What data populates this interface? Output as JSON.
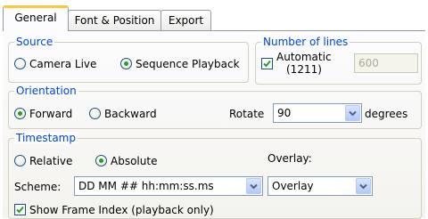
{
  "tabs": [
    {
      "label": "General",
      "active": true
    },
    {
      "label": "Font & Position",
      "active": false
    },
    {
      "label": "Export",
      "active": false
    }
  ],
  "source": {
    "legend": "Source",
    "options": [
      {
        "label": "Camera Live",
        "checked": false
      },
      {
        "label": "Sequence Playback",
        "checked": true
      }
    ]
  },
  "number_of_lines": {
    "legend": "Number of lines",
    "automatic_label": "Automatic",
    "automatic_count": "(1211)",
    "automatic_checked": true,
    "value": "600"
  },
  "orientation": {
    "legend": "Orientation",
    "forward_label": "Forward",
    "backward_label": "Backward",
    "selected": "Forward",
    "rotate_label": "Rotate",
    "rotate_value": "90",
    "degrees_label": "degrees"
  },
  "timestamp": {
    "legend": "Timestamp",
    "relative_label": "Relative",
    "absolute_label": "Absolute",
    "selected": "Absolute",
    "overlay_label": "Overlay:",
    "scheme_label": "Scheme:",
    "scheme_value": "DD MM ## hh:mm:ss.ms",
    "overlay_value": "Overlay",
    "show_frame_index_label": "Show Frame Index (playback only)",
    "show_frame_index_checked": true
  },
  "colors": {
    "legend_text": "#0046d5",
    "radio_dot": "#21a121",
    "tab_highlight": "#ffc83c"
  },
  "icons": {
    "dropdown": "chevron-down-icon",
    "checkbox_check": "checkmark-icon"
  }
}
